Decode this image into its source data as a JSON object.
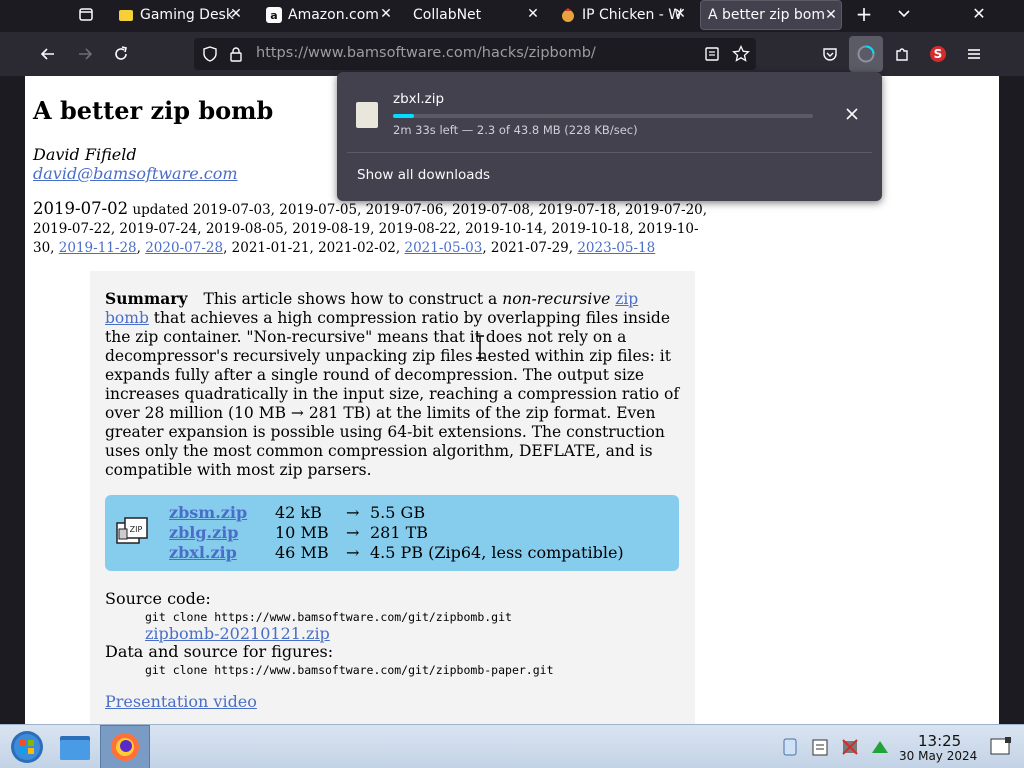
{
  "tabs": [
    {
      "title": "Gaming Desk",
      "favicon": "folder-yellow-icon"
    },
    {
      "title": "Amazon.com",
      "favicon": "amazon-icon"
    },
    {
      "title": "CollabNet",
      "favicon": "none"
    },
    {
      "title": "IP Chicken - W",
      "favicon": "chicken-icon"
    },
    {
      "title": "A better zip bom",
      "favicon": "none"
    }
  ],
  "toolbar": {
    "url_host": "https://www.bamsoftware.com",
    "url_path": "/hacks/zipbomb/"
  },
  "download": {
    "filename": "zbxl.zip",
    "progress": 0.05,
    "status": "2m 33s left — 2.3 of 43.8 MB (228 KB/sec)",
    "show_all": "Show all downloads"
  },
  "article": {
    "title": "A better zip bomb",
    "author": "David Fifield",
    "email": "david@bamsoftware.com",
    "date_main": "2019-07-02",
    "updated_prefix": "updated",
    "dates_plain_1": "2019-07-03, 2019-07-05, 2019-07-06, 2019-07-08, 2019-07-18, 2019-07-20, 2019-07-22, 2019-07-24, 2019-08-05, 2019-08-19, 2019-08-22, 2019-10-14, 2019-10-18, 2019-10-30,",
    "date_link_1": "2019-11-28",
    "date_link_2": "2020-07-28",
    "dates_plain_2": ", 2021-01-21, 2021-02-02, ",
    "date_link_3": "2021-05-03",
    "dates_plain_3": ", 2021-07-29, ",
    "date_link_4": "2023-05-18",
    "summary_label": "Summary",
    "summary_a": "This article shows how to construct a ",
    "summary_em": "non-recursive",
    "summary_link": "zip bomb",
    "summary_b": " that achieves a high compression ratio by overlapping files inside the zip container. \"Non-recursive\" means that it does not rely on a decompressor's recursively unpacking zip files nested within zip files: it expands fully after a single round of decompression. The output size increases quadratically in the input size, reaching a compression ratio of over 28 million (10 MB → 281 TB) at the limits of the zip format. Even greater expansion is possible using 64-bit extensions. The construction uses only the most common compression algorithm, DEFLATE, and is compatible with most zip parsers.",
    "files": [
      {
        "name": "zbsm.zip",
        "size": "42 kB",
        "arrow": "→",
        "result": "5.5 GB"
      },
      {
        "name": "zblg.zip",
        "size": "10 MB",
        "arrow": "→",
        "result": "281 TB"
      },
      {
        "name": "zbxl.zip",
        "size": "46 MB",
        "arrow": "→",
        "result": "4.5 PB (Zip64, less compatible)"
      }
    ],
    "source_label": "Source code:",
    "source_cmd": "git clone https://www.bamsoftware.com/git/zipbomb.git",
    "source_link": "zipbomb-20210121.zip",
    "figures_label": "Data and source for figures:",
    "figures_cmd": "git clone https://www.bamsoftware.com/git/zipbomb-paper.git",
    "video_link": "Presentation video"
  },
  "taskbar": {
    "time": "13:25",
    "date": "30 May 2024"
  }
}
